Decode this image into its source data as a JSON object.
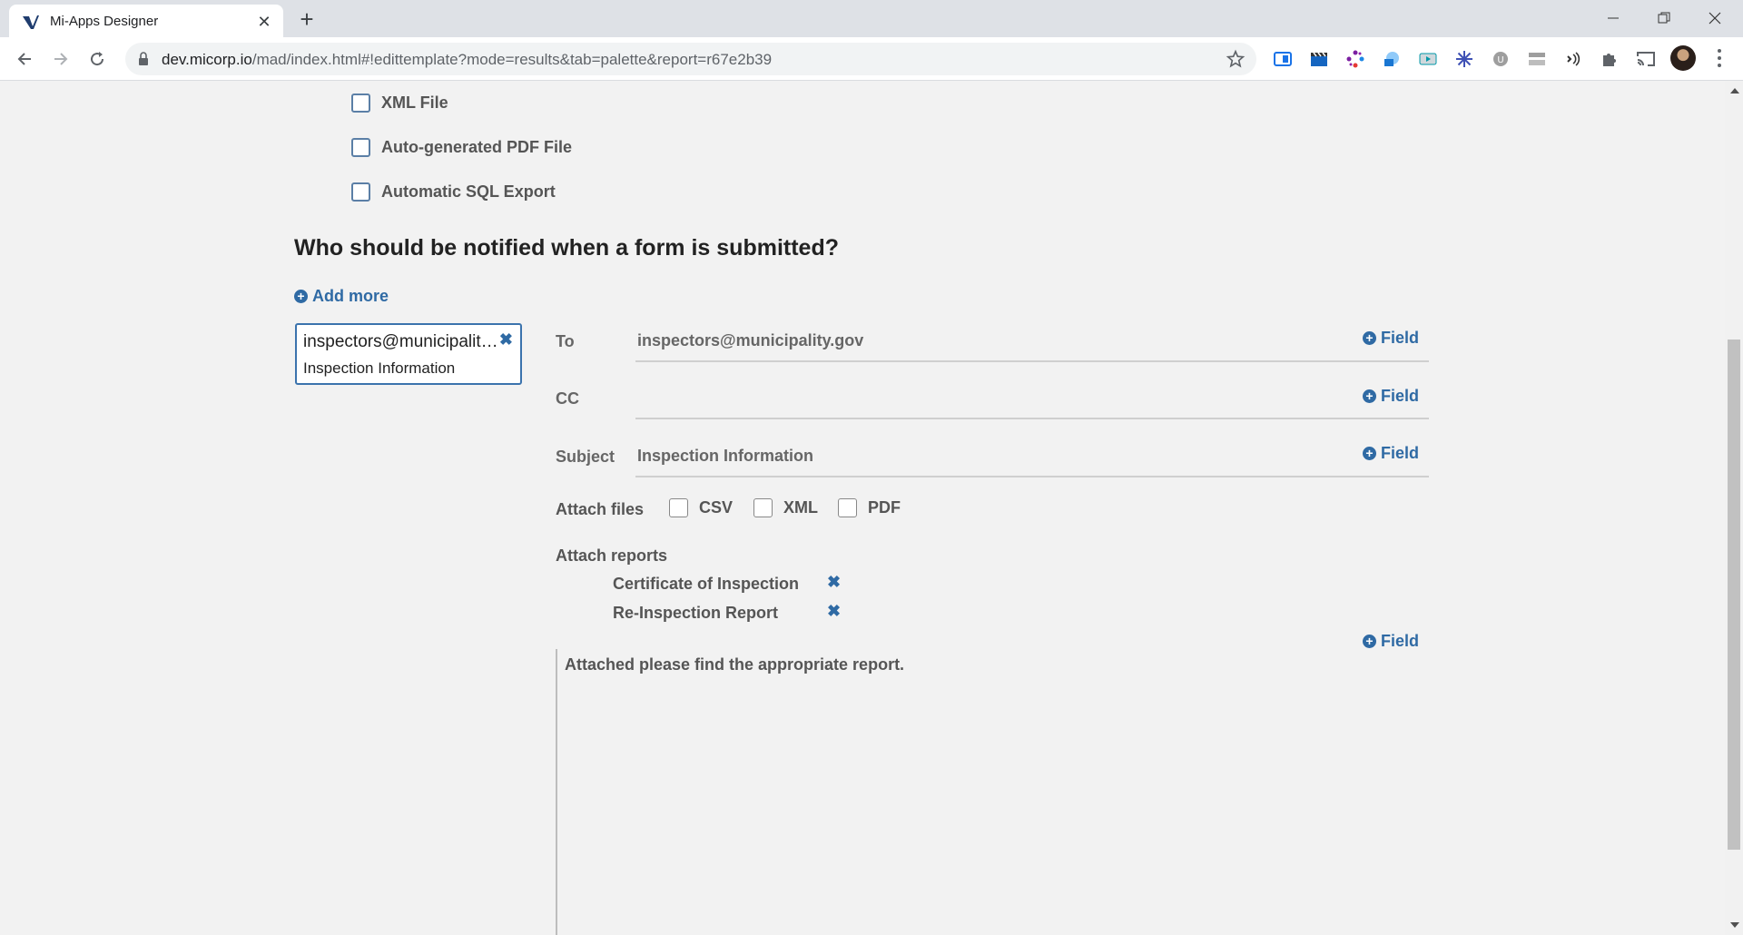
{
  "browser": {
    "tab_title": "Mi-Apps Designer",
    "url_host": "dev.micorp.io",
    "url_path": "/mad/index.html#!edittemplate?mode=results&tab=palette&report=r67e2b39"
  },
  "outputs": {
    "options": [
      {
        "label": "XML File"
      },
      {
        "label": "Auto-generated PDF File"
      },
      {
        "label": "Automatic SQL Export"
      }
    ]
  },
  "notifications": {
    "heading": "Who should be notified when a form is submitted?",
    "add_more_label": "Add more",
    "card": {
      "email": "inspectors@municipality.gov",
      "subject": "Inspection Information"
    }
  },
  "email_form": {
    "to_label": "To",
    "to_value": "inspectors@municipality.gov",
    "cc_label": "CC",
    "cc_value": "",
    "subject_label": "Subject",
    "subject_value": "Inspection Information",
    "field_button_label": "Field",
    "attach_files_label": "Attach files",
    "file_types": [
      "CSV",
      "XML",
      "PDF"
    ],
    "attach_reports_label": "Attach reports",
    "reports": [
      "Certificate of Inspection",
      "Re-Inspection Report"
    ],
    "body_text": "Attached please find the appropriate report."
  }
}
